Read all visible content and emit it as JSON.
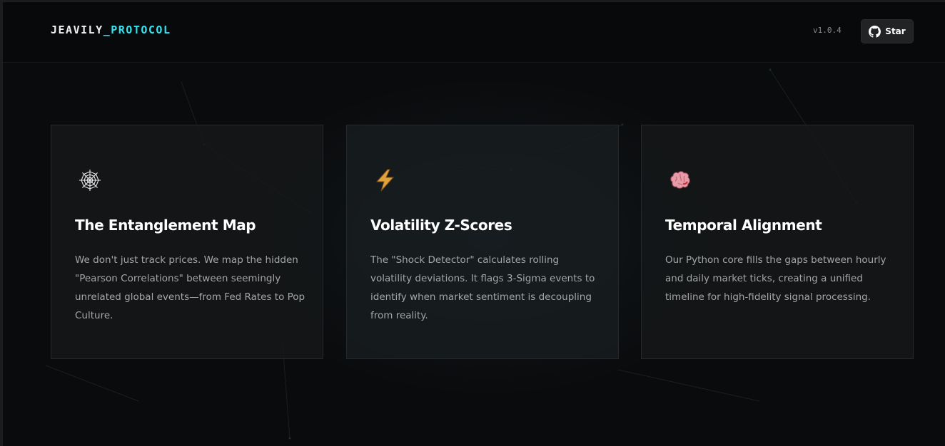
{
  "header": {
    "brand_main": "JEAVILY",
    "brand_accent": "_PROTOCOL",
    "version": "v1.0.4",
    "star_label": "Star",
    "star_icon": "github-icon"
  },
  "cards": [
    {
      "icon": "spider-web-icon",
      "title": "The Entanglement Map",
      "description": "We don't just track prices. We map the hidden \"Pearson Correlations\" between seemingly unrelated global events—from Fed Rates to Pop Culture."
    },
    {
      "icon": "lightning-bolt-icon",
      "title": "Volatility Z-Scores",
      "description": "The \"Shock Detector\" calculates rolling volatility deviations. It flags 3-Sigma events to identify when market sentiment is decoupling from reality."
    },
    {
      "icon": "brain-icon",
      "title": "Temporal Alignment",
      "description": "Our Python core fills the gaps between hourly and daily market ticks, creating a unified timeline for high-fidelity signal processing."
    }
  ],
  "colors": {
    "background": "#0a0b0d",
    "accent": "#2ee6f2",
    "card_border": "#26282b",
    "text_primary": "#ffffff",
    "text_secondary": "#a4a6a9"
  }
}
